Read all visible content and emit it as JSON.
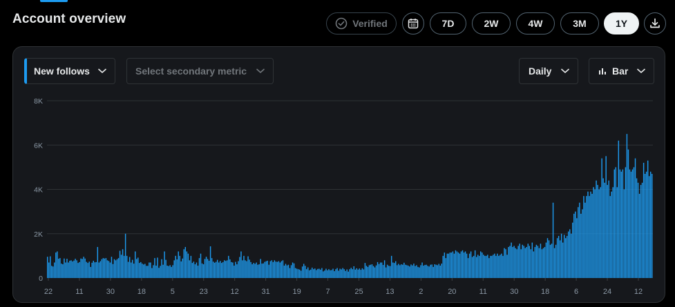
{
  "header": {
    "title": "Account overview"
  },
  "toolbar": {
    "verified_label": "Verified",
    "ranges": [
      "7D",
      "2W",
      "4W",
      "3M",
      "1Y"
    ],
    "active_range": "1Y",
    "calendar_icon": "calendar-icon",
    "download_icon": "download-icon"
  },
  "controls": {
    "primary_metric": "New follows",
    "secondary_metric_placeholder": "Select secondary metric",
    "granularity": "Daily",
    "chart_type_label": "Bar"
  },
  "colors": {
    "bar": "#1d9bf0",
    "accent": "#1d9bf0",
    "panel": "#16181c",
    "active_pill": "#eff3f4"
  },
  "chart_data": {
    "type": "bar",
    "title": "",
    "xlabel": "",
    "ylabel": "",
    "ylim": [
      0,
      8000
    ],
    "yticks": [
      "0",
      "2K",
      "4K",
      "6K",
      "8K"
    ],
    "x_tick_labels": [
      "22",
      "11",
      "30",
      "18",
      "5",
      "23",
      "12",
      "31",
      "19",
      "7",
      "25",
      "13",
      "2",
      "20",
      "11",
      "30",
      "18",
      "6",
      "24",
      "12"
    ],
    "grid": true,
    "series": [
      {
        "values": [
          960,
          700,
          980,
          550,
          520,
          700,
          1150,
          1200,
          870,
          900,
          650,
          620,
          880,
          700,
          870,
          700,
          780,
          800,
          750,
          790,
          870,
          800,
          680,
          720,
          880,
          860,
          960,
          880,
          730,
          680,
          740,
          500,
          690,
          780,
          710,
          720,
          1400,
          700,
          760,
          850,
          900,
          880,
          900,
          800,
          770,
          700,
          960,
          630,
          850,
          800,
          850,
          900,
          1230,
          1050,
          1300,
          1000,
          2000,
          1000,
          730,
          950,
          700,
          820,
          650,
          1200,
          860,
          920,
          680,
          720,
          650,
          610,
          640,
          550,
          550,
          700,
          700,
          450,
          580,
          900,
          560,
          920,
          460,
          550,
          850,
          600,
          1200,
          820,
          560,
          540,
          580,
          500,
          580,
          800,
          1000,
          840,
          1200,
          1000,
          750,
          880,
          1300,
          1400,
          1200,
          1100,
          800,
          1000,
          680,
          740,
          620,
          700,
          560,
          900,
          1100,
          660,
          620,
          860,
          960,
          860,
          780,
          1430,
          900,
          740,
          690,
          730,
          820,
          700,
          770,
          680,
          720,
          800,
          770,
          800,
          1000,
          840,
          720,
          700,
          560,
          730,
          620,
          760,
          950,
          1200,
          800,
          1000,
          800,
          760,
          980,
          830,
          720,
          620,
          680,
          640,
          700,
          600,
          620,
          860,
          650,
          660,
          730,
          760,
          780,
          600,
          760,
          800,
          720,
          800,
          740,
          730,
          760,
          700,
          760,
          800,
          560,
          640,
          570,
          600,
          450,
          580,
          700,
          660,
          450,
          420,
          400,
          380,
          330,
          520,
          640,
          550,
          400,
          480,
          350,
          380,
          470,
          400,
          430,
          360,
          410,
          420,
          380,
          450,
          300,
          340,
          420,
          350,
          400,
          350,
          360,
          420,
          310,
          400,
          450,
          330,
          420,
          390,
          450,
          400,
          320,
          390,
          290,
          400,
          460,
          400,
          530,
          380,
          440,
          380,
          430,
          370,
          440,
          390,
          680,
          550,
          500,
          580,
          600,
          620,
          540,
          480,
          570,
          720,
          630,
          700,
          700,
          590,
          800,
          480,
          600,
          550,
          540,
          1000,
          700,
          680,
          760,
          580,
          640,
          580,
          620,
          600,
          690,
          600,
          580,
          560,
          520,
          610,
          570,
          650,
          540,
          580,
          500,
          480,
          580,
          700,
          560,
          590,
          600,
          550,
          520,
          600,
          610,
          500,
          620,
          600,
          580,
          640,
          560,
          650,
          1000,
          1150,
          900,
          1100,
          1100,
          1150,
          1150,
          1200,
          1100,
          1250,
          1200,
          1150,
          1100,
          1200,
          1250,
          1150,
          1200,
          1100,
          900,
          1100,
          1200,
          950,
          1000,
          1250,
          950,
          1050,
          1000,
          1200,
          1150,
          1050,
          1000,
          1000,
          1050,
          900,
          1000,
          1000,
          1050,
          1100,
          1000,
          1100,
          1000,
          1050,
          1100,
          1000,
          1350,
          1300,
          1050,
          1400,
          1450,
          1600,
          1400,
          1450,
          1350,
          1300,
          1450,
          1550,
          1300,
          1500,
          1450,
          1350,
          1400,
          1550,
          1450,
          1300,
          1600,
          1200,
          1400,
          1500,
          1450,
          1350,
          1550,
          1300,
          1350,
          1400,
          1600,
          1800,
          1700,
          1500,
          1550,
          3400,
          1350,
          1500,
          1800,
          1900,
          1700,
          2000,
          1600,
          1950,
          1800,
          1900,
          2100,
          2200,
          2000,
          2500,
          2900,
          3000,
          2700,
          3200,
          3400,
          2900,
          3100,
          3700,
          3400,
          3700,
          3900,
          3700,
          3900,
          3800,
          4100,
          4000,
          4400,
          4200,
          4000,
          4100,
          5400,
          4500,
          4300,
          5500,
          4200,
          4400,
          3700,
          3900,
          4100,
          4900,
          5000,
          4100,
          6200,
          4900,
          4800,
          4900,
          4000,
          5000,
          6500,
          5800,
          4900,
          4800,
          4900,
          5000,
          5400,
          4500,
          4300,
          3800,
          4200,
          4300,
          5200,
          4700,
          4800,
          5300,
          4600,
          4800,
          4700
        ]
      }
    ]
  }
}
